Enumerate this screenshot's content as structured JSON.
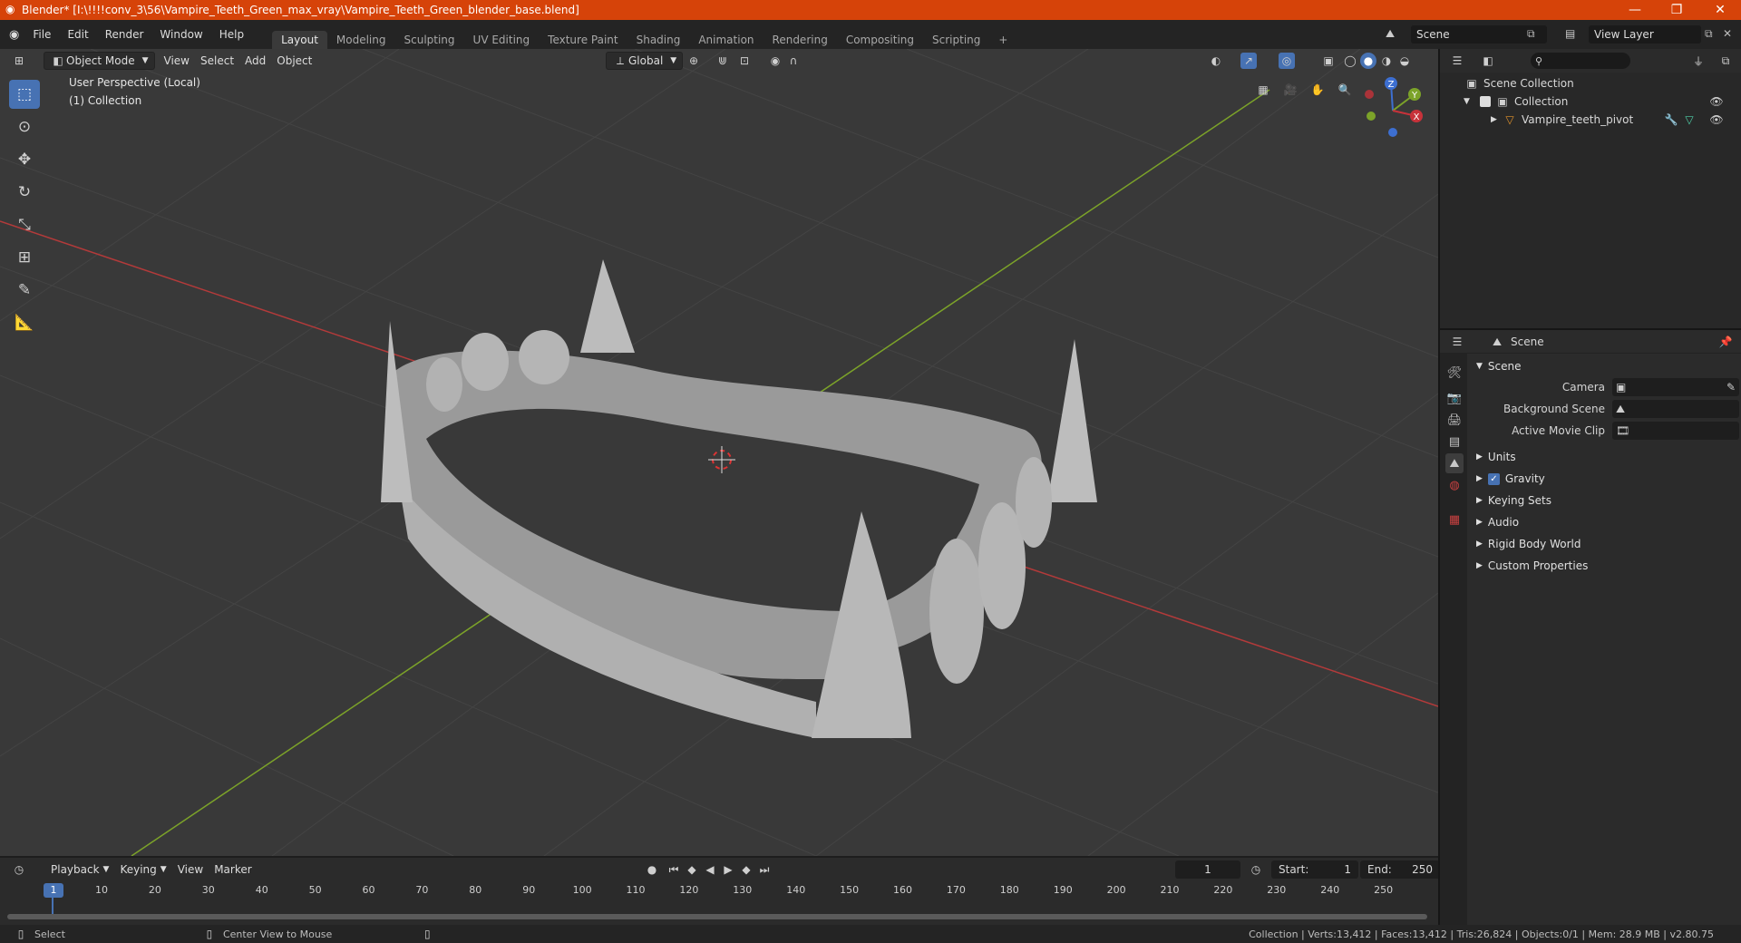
{
  "window": {
    "title": "Blender* [I:\\!!!!conv_3\\56\\Vampire_Teeth_Green_max_vray\\Vampire_Teeth_Green_blender_base.blend]",
    "minimize": "—",
    "maximize": "❐",
    "close": "✕"
  },
  "menu": {
    "items": [
      "File",
      "Edit",
      "Render",
      "Window",
      "Help"
    ],
    "workspaces": [
      "Layout",
      "Modeling",
      "Sculpting",
      "UV Editing",
      "Texture Paint",
      "Shading",
      "Animation",
      "Rendering",
      "Compositing",
      "Scripting"
    ],
    "active_workspace": "Layout",
    "add_workspace": "+",
    "scene": "Scene",
    "view_layer": "View Layer"
  },
  "viewport": {
    "mode": "Object Mode",
    "menus": [
      "View",
      "Select",
      "Add",
      "Object"
    ],
    "transform_orientation": "Global",
    "overlay_line1": "User Perspective (Local)",
    "overlay_line2": "(1) Collection",
    "gizmo": {
      "z": "Z",
      "y": "Y",
      "x": "X"
    }
  },
  "outliner": {
    "search_placeholder": "",
    "root": "Scene Collection",
    "collection": "Collection",
    "object": "Vampire_teeth_pivot"
  },
  "properties": {
    "context": "Scene",
    "panel_title": "Scene",
    "camera_label": "Camera",
    "background_scene_label": "Background Scene",
    "active_movie_clip_label": "Active Movie Clip",
    "panels": [
      "Units",
      "Gravity",
      "Keying Sets",
      "Audio",
      "Rigid Body World",
      "Custom Properties"
    ],
    "gravity_checked": true
  },
  "timeline": {
    "menus": [
      "Playback",
      "Keying",
      "View",
      "Marker"
    ],
    "current_frame": "1",
    "start_label": "Start:",
    "start": "1",
    "end_label": "End:",
    "end": "250",
    "ticks": [
      "1",
      "10",
      "20",
      "30",
      "40",
      "50",
      "60",
      "70",
      "80",
      "90",
      "100",
      "110",
      "120",
      "130",
      "140",
      "150",
      "160",
      "170",
      "180",
      "190",
      "200",
      "210",
      "220",
      "230",
      "240",
      "250"
    ]
  },
  "status": {
    "left_action": "Select",
    "middle_action": "Center View to Mouse",
    "stats": "Collection | Verts:13,412 | Faces:13,412 | Tris:26,824 | Objects:0/1 | Mem: 28.9 MB | v2.80.75"
  },
  "colors": {
    "titlebar": "#d64309",
    "accent": "#4772b3",
    "x_axis": "#b33a3a",
    "y_axis": "#7ca329",
    "model": "#a8a8a8"
  }
}
